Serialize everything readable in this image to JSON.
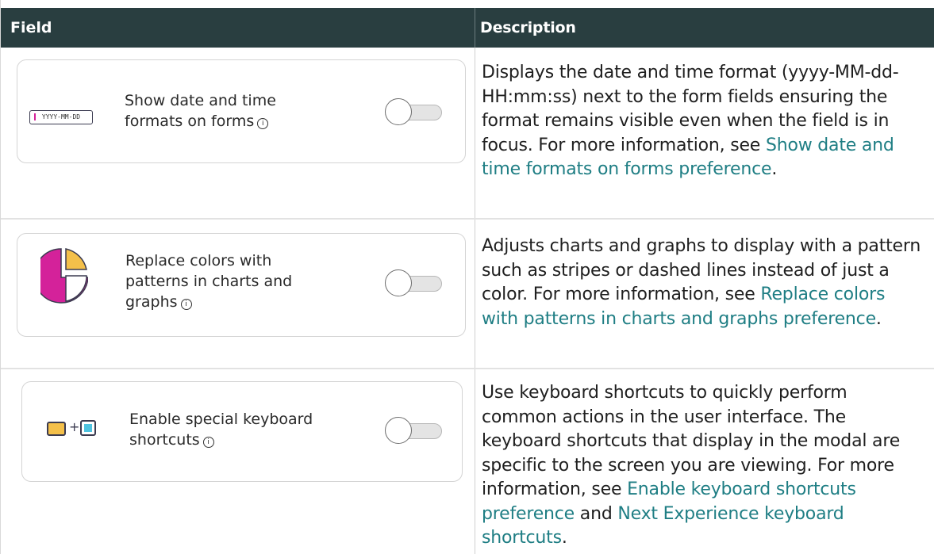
{
  "header": {
    "field": "Field",
    "description": "Description"
  },
  "rows": [
    {
      "label_line1": "Show date and time",
      "label_line2": "formats on forms",
      "badge_text": "YYYY-MM-DD",
      "toggle_on": false,
      "desc_text": "Displays the date and time format (yyyy-MM-dd-HH:mm:ss) next to the form fields ensuring the format remains visible even when the field is in focus. For more information, see ",
      "link1": "Show date and time formats on forms preference",
      "desc_end": "."
    },
    {
      "label_line1": "Replace colors with",
      "label_line2": "patterns in charts and",
      "label_line3": "graphs",
      "toggle_on": false,
      "desc_text": "Adjusts charts and graphs to display with a pattern such as stripes or dashed lines instead of just a color. For more information, see ",
      "link1": "Replace colors with patterns in charts and graphs preference",
      "desc_end": "."
    },
    {
      "label_line1": "Enable special keyboard",
      "label_line2": "shortcuts",
      "plus": "+",
      "toggle_on": false,
      "desc_text": "Use keyboard shortcuts to quickly perform common actions in the user interface. The keyboard shortcuts that display in the modal are specific to the screen you are viewing. For more information, see ",
      "link1": "Enable keyboard shortcuts preference",
      "desc_mid": " and ",
      "link2": "Next Experience keyboard shortcuts",
      "desc_end": "."
    }
  ],
  "info_glyph": "i",
  "colors": {
    "header_bg": "#293e40",
    "link": "#1f7e84",
    "pie_magenta": "#d4229a",
    "pie_yellow": "#f4c04a",
    "kbd_yellow": "#f4c04a",
    "kbd_cyan": "#4fc3e0"
  }
}
